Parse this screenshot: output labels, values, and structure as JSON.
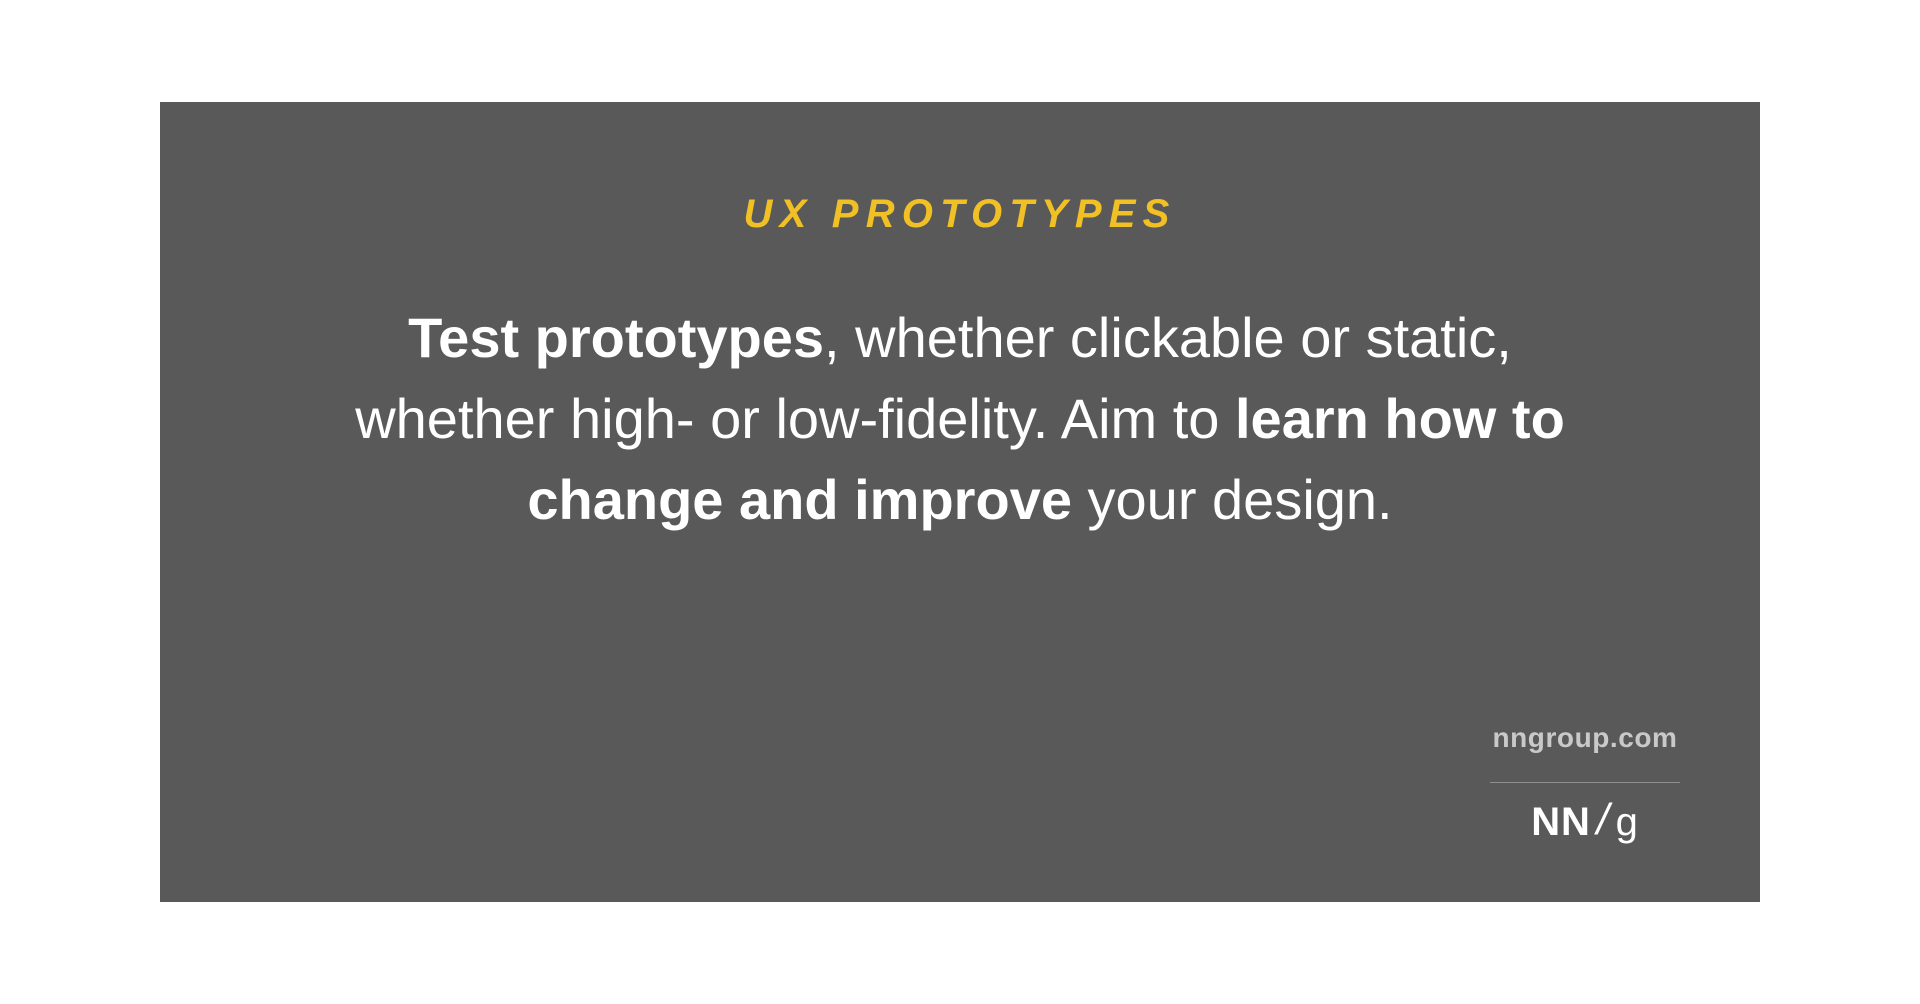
{
  "slide": {
    "heading": "UX PROTOTYPES",
    "body": {
      "seg1_bold": "Test prototypes",
      "seg2": ", whether clickable or static, whether high- or low-fidelity. Aim to ",
      "seg3_bold": "learn how to change and improve",
      "seg4": " your design."
    },
    "footer": {
      "url": "nngroup.com",
      "logo_nn": "NN",
      "logo_slash": "/",
      "logo_g": "g"
    }
  },
  "colors": {
    "background": "#595959",
    "accent": "#f0c024",
    "text": "#ffffff",
    "muted": "#c9c9c9"
  }
}
